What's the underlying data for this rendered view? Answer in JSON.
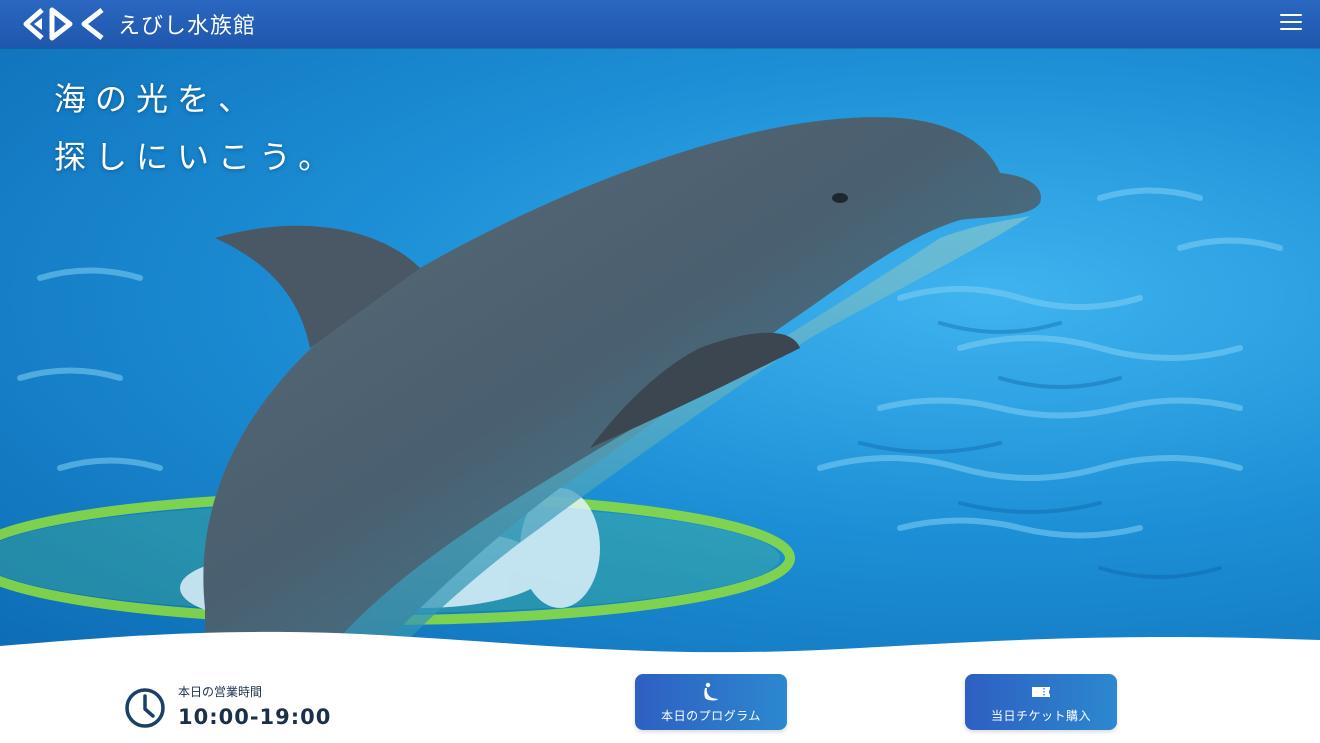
{
  "header": {
    "logo_text": "えびし水族館"
  },
  "hero": {
    "catch_line1": "海の光を、",
    "catch_line2": "探しにいこう。"
  },
  "info": {
    "hours_label": "本日の営業時間",
    "hours_value": "10:00-19:00"
  },
  "actions": {
    "program_label": "本日のプログラム",
    "ticket_label": "当日チケット購入"
  },
  "icons": {
    "logo": "aquarium-logo-icon",
    "menu": "hamburger-menu-icon",
    "clock": "clock-icon",
    "program": "seal-icon",
    "ticket": "ticket-icon"
  },
  "colors": {
    "header": "#2a67c0",
    "button_start": "#2e5fc2",
    "button_end": "#2c88cf",
    "clock": "#1b3f66",
    "text_dark": "#1b2f4a"
  }
}
